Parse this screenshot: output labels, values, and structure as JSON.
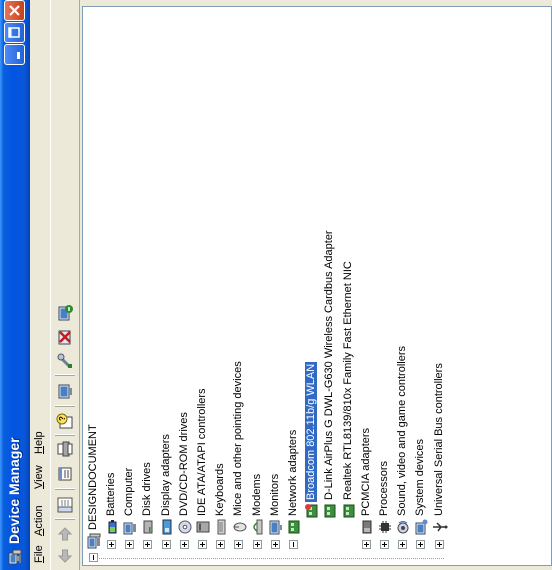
{
  "window": {
    "title": "Device Manager"
  },
  "menu": {
    "file": {
      "acc": "F",
      "rest": "ile"
    },
    "action": {
      "acc": "A",
      "rest": "ction"
    },
    "view": {
      "acc": "V",
      "rest": "iew"
    },
    "help": {
      "acc": "H",
      "rest": "elp"
    }
  },
  "tree": {
    "root": "DESIGNDOCUMENT",
    "categories": [
      {
        "label": "Batteries",
        "expanded": false
      },
      {
        "label": "Computer",
        "expanded": false
      },
      {
        "label": "Disk drives",
        "expanded": false
      },
      {
        "label": "Display adapters",
        "expanded": false
      },
      {
        "label": "DVD/CD-ROM drives",
        "expanded": false
      },
      {
        "label": "IDE ATA/ATAPI controllers",
        "expanded": false
      },
      {
        "label": "Keyboards",
        "expanded": false
      },
      {
        "label": "Mice and other pointing devices",
        "expanded": false
      },
      {
        "label": "Modems",
        "expanded": false
      },
      {
        "label": "Monitors",
        "expanded": false
      },
      {
        "label": "Network adapters",
        "expanded": true
      },
      {
        "label": "PCMCIA adapters",
        "expanded": false
      },
      {
        "label": "Processors",
        "expanded": false
      },
      {
        "label": "Sound, video and game controllers",
        "expanded": false
      },
      {
        "label": "System devices",
        "expanded": false
      },
      {
        "label": "Universal Serial Bus controllers",
        "expanded": false
      }
    ],
    "network_children": [
      {
        "label": "Broadcom 802.11b/g WLAN",
        "selected": true
      },
      {
        "label": "D-Link AirPlus G DWL-G630 Wireless Cardbus Adapter",
        "selected": false
      },
      {
        "label": "Realtek RTL8139/810x Family Fast Ethernet NIC",
        "selected": false
      }
    ]
  },
  "colors": {
    "titlebar": "#0054e3",
    "selection": "#316ac5",
    "window_bg": "#ece9d8"
  }
}
